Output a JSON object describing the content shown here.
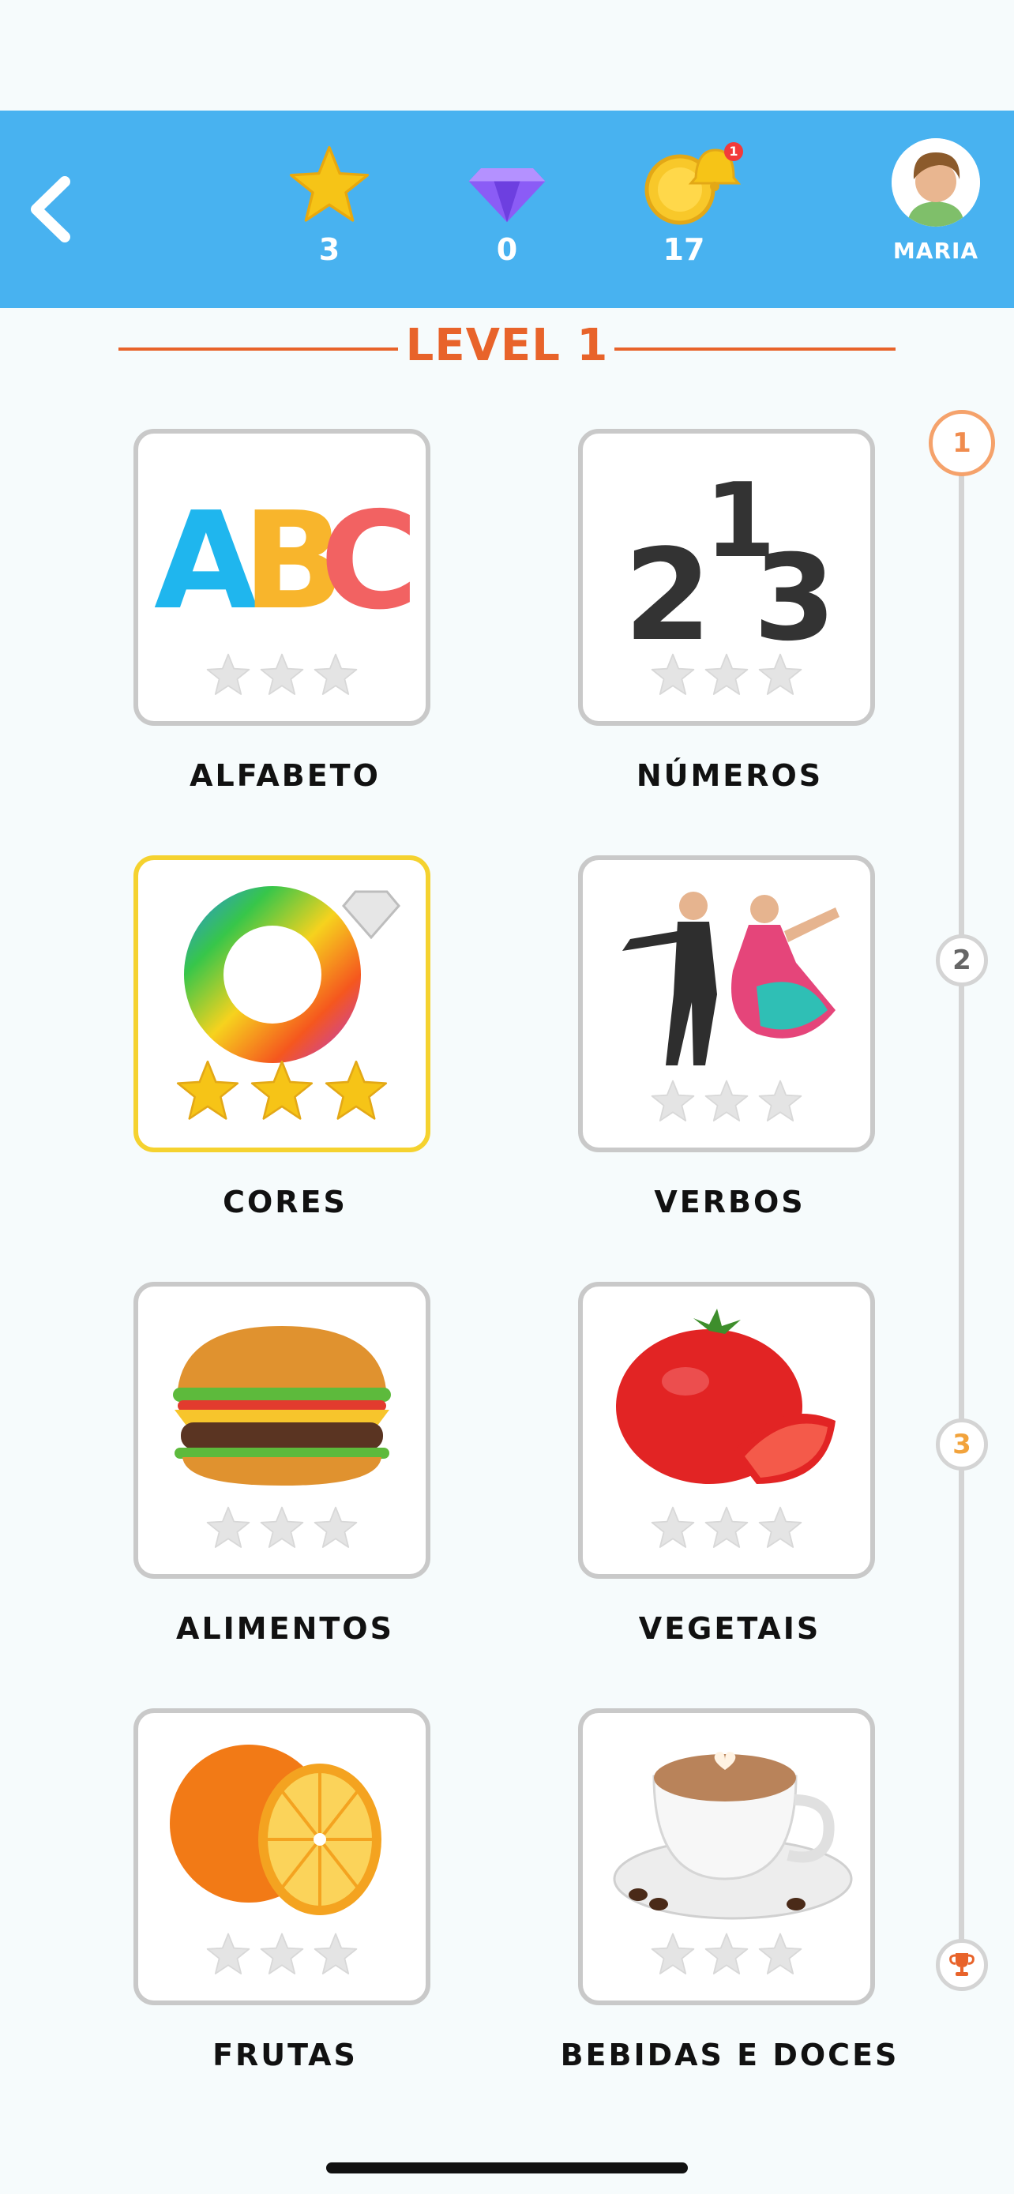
{
  "header": {
    "stars_count": "3",
    "gems_count": "0",
    "coins_count": "17",
    "notification_count": "1",
    "profile_name": "MARIA"
  },
  "level": {
    "title": "LEVEL 1"
  },
  "cards": [
    {
      "label": "ALFABETO",
      "art_text_a": "A",
      "art_text_b": "B",
      "art_text_c": "C",
      "stars_earned": 0
    },
    {
      "label": "NÚMEROS",
      "art_text_1": "1",
      "art_text_2": "2",
      "art_text_3": "3",
      "stars_earned": 0
    },
    {
      "label": "CORES",
      "stars_earned": 3
    },
    {
      "label": "VERBOS",
      "stars_earned": 0
    },
    {
      "label": "ALIMENTOS",
      "stars_earned": 0
    },
    {
      "label": "VEGETAIS",
      "stars_earned": 0
    },
    {
      "label": "FRUTAS",
      "stars_earned": 0
    },
    {
      "label": "BEBIDAS E DOCES",
      "stars_earned": 0
    }
  ],
  "progress": {
    "nodes": [
      "1",
      "2",
      "3"
    ],
    "current_node": "1"
  },
  "colors": {
    "header_bg": "#48B2F0",
    "accent": "#E8632A",
    "active_border": "#F5D22F",
    "card_border": "#C9C9C9",
    "star_gold": "#F6C417",
    "star_empty": "#E4E4E4"
  }
}
